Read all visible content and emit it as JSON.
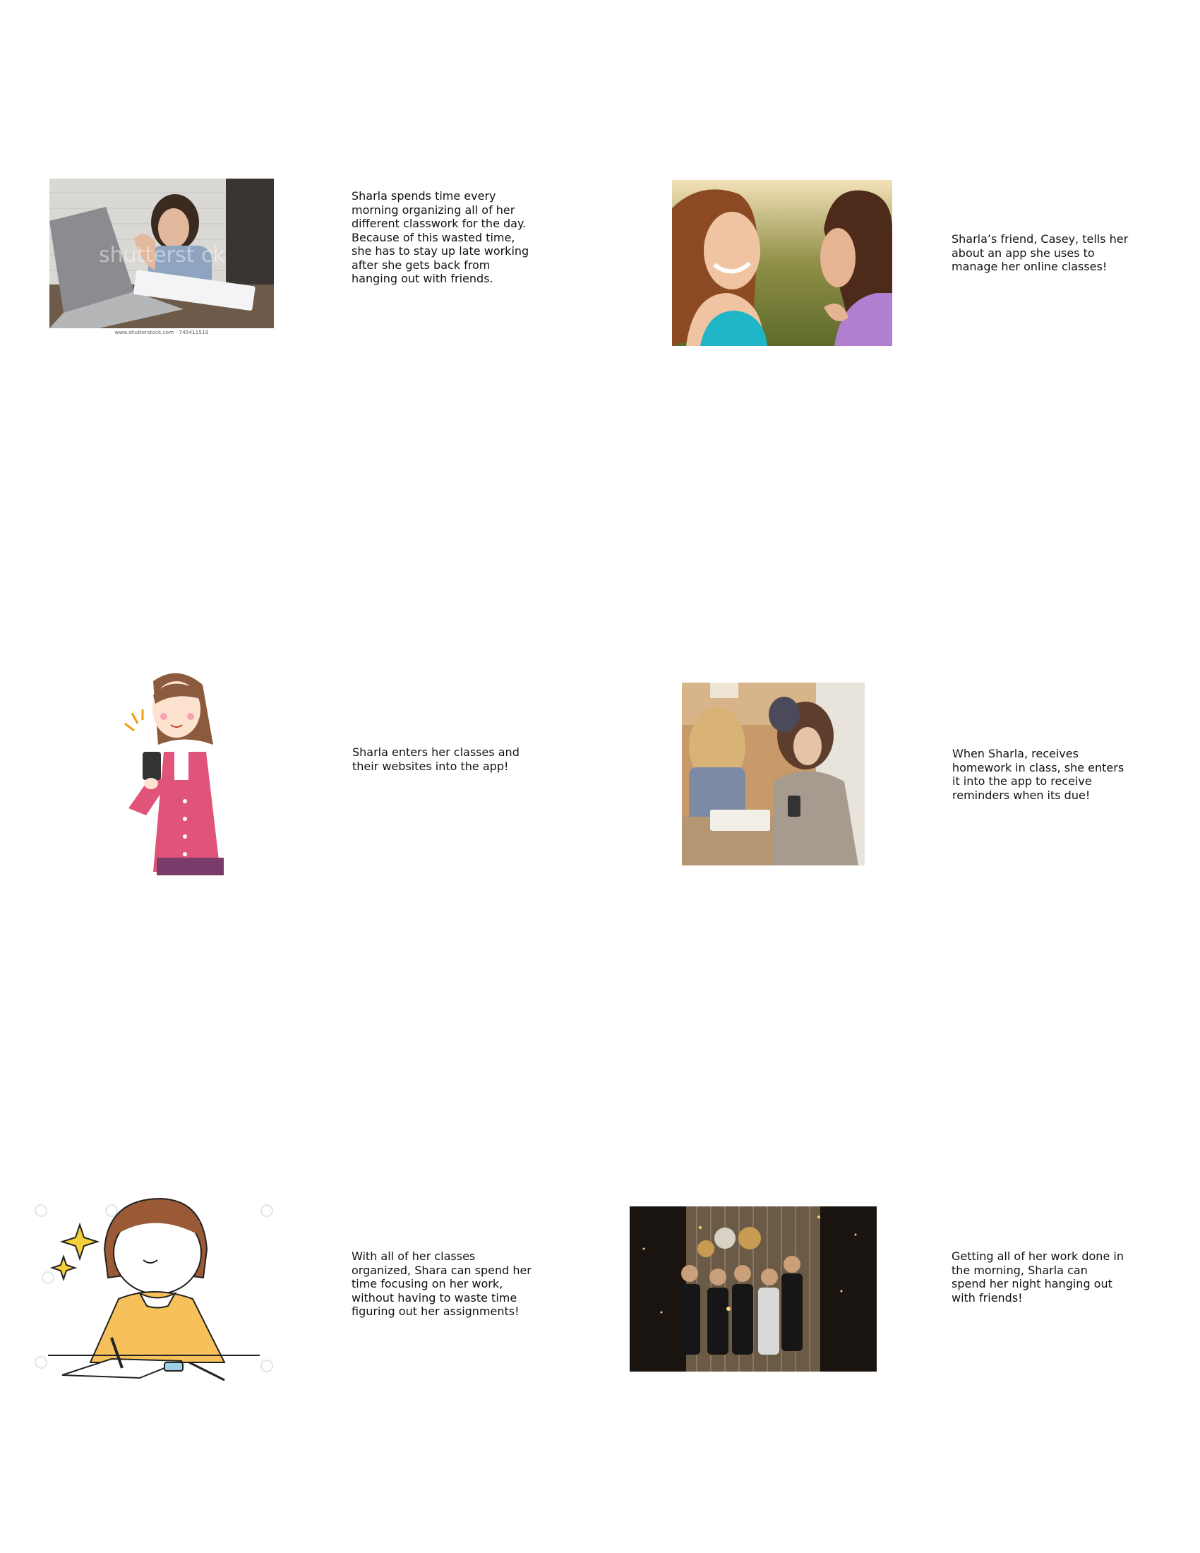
{
  "panels": [
    {
      "caption": "Sharla spends time every morning organizing all of her different classwork for the day. Because of this wasted time, she has to stay up late working after she gets back from hanging out with friends.",
      "image": "stressed-student-laptop-photo",
      "watermark": "shutterst ck",
      "credit": "www.shutterstock.com · 745411519"
    },
    {
      "caption": "Sharla’s friend, Casey, tells her about an app she uses to manage her online classes!",
      "image": "two-friends-talking-illustration"
    },
    {
      "caption": "Sharla enters her classes and their websites into the app!",
      "image": "woman-using-phone-illustration"
    },
    {
      "caption": "When Sharla, receives homework in class, she enters it into the app to receive reminders when its due!",
      "image": "student-phone-in-classroom-photo"
    },
    {
      "caption": "With all of her classes organized, Shara can spend her time focusing on her work, without having to waste time figuring out her assignments!",
      "image": "girl-writing-notebook-illustration"
    },
    {
      "caption": "Getting all of her work done in the morning, Sharla can spend her night hanging out with friends!",
      "image": "friends-party-photo"
    }
  ]
}
